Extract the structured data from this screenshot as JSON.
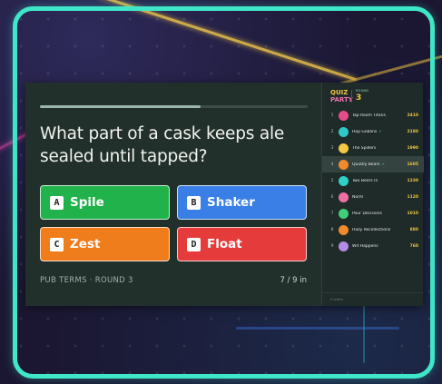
{
  "question": "What part of a cask keeps ale sealed until tapped?",
  "progress": 0.6,
  "answers": [
    {
      "key": "A",
      "label": "Spile",
      "color": "#22b24b"
    },
    {
      "key": "B",
      "label": "Shaker",
      "color": "#3a7fe6"
    },
    {
      "key": "C",
      "label": "Zest",
      "color": "#f07d1c"
    },
    {
      "key": "D",
      "label": "Float",
      "color": "#e53b3b"
    }
  ],
  "footer": {
    "round_label": "PUB TERMS · ROUND 3",
    "answered_count": "7 / 9 in"
  },
  "scoreboard": {
    "logo_line1": "QUIZ",
    "logo_line2": "PARTY",
    "round_label": "ROUND",
    "round_number": "3",
    "teams": [
      {
        "rank": "1",
        "name": "Tap Room Titans",
        "answered": false,
        "score": "2410",
        "avatar": "#e94b8a"
      },
      {
        "rank": "2",
        "name": "Hop Goblins",
        "answered": true,
        "score": "2180",
        "avatar": "#2fc7c7"
      },
      {
        "rank": "3",
        "name": "The Spillers",
        "answered": false,
        "score": "1990",
        "avatar": "#f3c843"
      },
      {
        "rank": "4",
        "name": "Quizzly Bears",
        "answered": true,
        "score": "1605",
        "avatar": "#f08a2c"
      },
      {
        "rank": "5",
        "name": "Two Beers In",
        "answered": false,
        "score": "1230",
        "avatar": "#2fd0c5"
      },
      {
        "rank": "6",
        "name": "Norm",
        "answered": false,
        "score": "1120",
        "avatar": "#ef6fa5"
      },
      {
        "rank": "7",
        "name": "Pour Decisions",
        "answered": false,
        "score": "1010",
        "avatar": "#3fcf7a"
      },
      {
        "rank": "8",
        "name": "Hazy Recollections",
        "answered": false,
        "score": "880",
        "avatar": "#f08a2c"
      },
      {
        "rank": "9",
        "name": "Wit Happens",
        "answered": false,
        "score": "760",
        "avatar": "#b68be8"
      }
    ],
    "footer": "9 teams"
  },
  "check_mark": "✓"
}
